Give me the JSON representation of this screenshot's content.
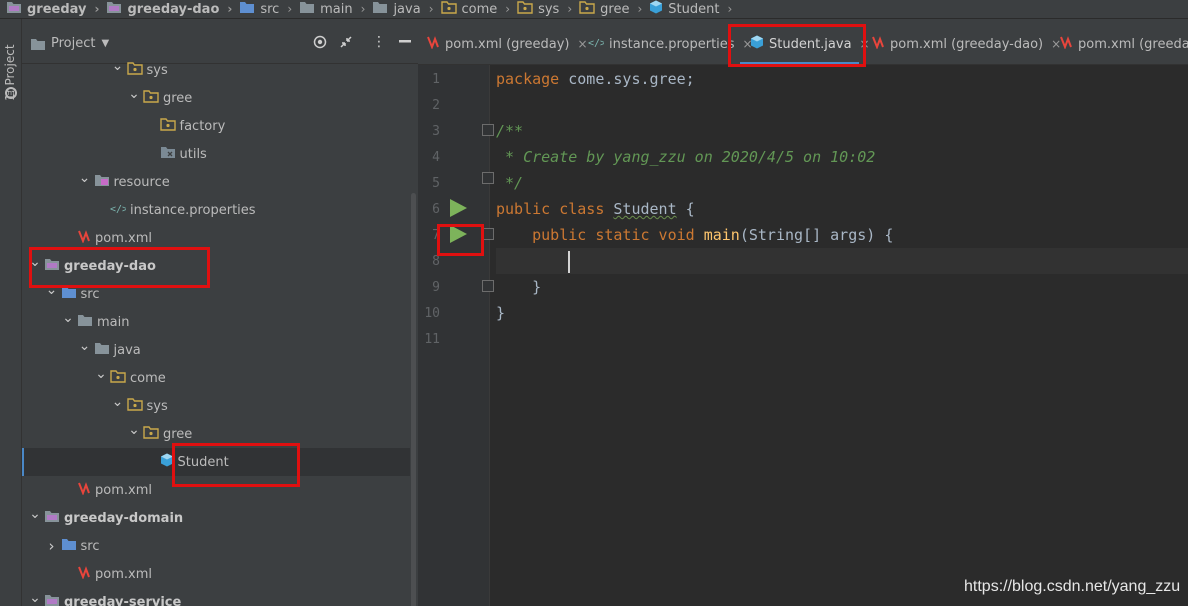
{
  "breadcrumb": [
    {
      "label": "greeday",
      "icon": "module-folder-icon",
      "bold": true
    },
    {
      "label": "greeday-dao",
      "icon": "module-folder-icon",
      "bold": true
    },
    {
      "label": "src",
      "icon": "source-folder-icon",
      "bold": false
    },
    {
      "label": "main",
      "icon": "folder-icon",
      "bold": false
    },
    {
      "label": "java",
      "icon": "folder-icon",
      "bold": false
    },
    {
      "label": "come",
      "icon": "package-icon",
      "bold": false
    },
    {
      "label": "sys",
      "icon": "package-icon",
      "bold": false
    },
    {
      "label": "gree",
      "icon": "package-icon",
      "bold": false
    },
    {
      "label": "Student",
      "icon": "java-class-icon",
      "bold": false
    }
  ],
  "toolstrip": {
    "project_label": "1: Project"
  },
  "project_panel": {
    "title": "Project"
  },
  "tree": [
    {
      "label": "sys",
      "arrow": "down",
      "icon": "package-icon",
      "indent": 6,
      "bold": false
    },
    {
      "label": "gree",
      "arrow": "down",
      "icon": "package-icon",
      "indent": 7,
      "bold": false
    },
    {
      "label": "factory",
      "arrow": "none",
      "icon": "package-icon",
      "indent": 8,
      "bold": false
    },
    {
      "label": "utils",
      "arrow": "none",
      "icon": "excluded-folder-icon",
      "indent": 8,
      "bold": false
    },
    {
      "label": "resource",
      "arrow": "down",
      "icon": "resource-folder-icon",
      "indent": 4,
      "bold": false
    },
    {
      "label": "instance.properties",
      "arrow": "none",
      "icon": "properties-file-icon",
      "indent": 5,
      "bold": false
    },
    {
      "label": "pom.xml",
      "arrow": "none",
      "icon": "maven-icon",
      "indent": 3,
      "bold": false
    },
    {
      "label": "greeday-dao",
      "arrow": "down",
      "icon": "module-folder-icon",
      "indent": 1,
      "bold": true
    },
    {
      "label": "src",
      "arrow": "down",
      "icon": "source-folder-icon",
      "indent": 2,
      "bold": false
    },
    {
      "label": "main",
      "arrow": "down",
      "icon": "folder-icon",
      "indent": 3,
      "bold": false
    },
    {
      "label": "java",
      "arrow": "down",
      "icon": "folder-icon",
      "indent": 4,
      "bold": false
    },
    {
      "label": "come",
      "arrow": "down",
      "icon": "package-icon",
      "indent": 5,
      "bold": false
    },
    {
      "label": "sys",
      "arrow": "down",
      "icon": "package-icon",
      "indent": 6,
      "bold": false
    },
    {
      "label": "gree",
      "arrow": "down",
      "icon": "package-icon",
      "indent": 7,
      "bold": false
    },
    {
      "label": "Student",
      "arrow": "none",
      "icon": "java-class-icon",
      "indent": 8,
      "bold": false,
      "selected": true
    },
    {
      "label": "pom.xml",
      "arrow": "none",
      "icon": "maven-icon",
      "indent": 3,
      "bold": false
    },
    {
      "label": "greeday-domain",
      "arrow": "down",
      "icon": "module-folder-icon",
      "indent": 1,
      "bold": true
    },
    {
      "label": "src",
      "arrow": "right",
      "icon": "source-folder-icon",
      "indent": 2,
      "bold": false
    },
    {
      "label": "pom.xml",
      "arrow": "none",
      "icon": "maven-icon",
      "indent": 3,
      "bold": false
    },
    {
      "label": "greeday-service",
      "arrow": "down",
      "icon": "module-folder-icon",
      "indent": 1,
      "bold": true
    }
  ],
  "tabs": [
    {
      "label": "pom.xml (greeday)",
      "icon": "maven-icon",
      "active": false
    },
    {
      "label": "instance.properties",
      "icon": "properties-file-icon",
      "active": false
    },
    {
      "label": "Student.java",
      "icon": "java-class-icon",
      "active": true
    },
    {
      "label": "pom.xml (greeday-dao)",
      "icon": "maven-icon",
      "active": false
    },
    {
      "label": "pom.xml (greeday-",
      "icon": "maven-icon",
      "active": false
    }
  ],
  "editor": {
    "line_numbers": [
      "1",
      "2",
      "3",
      "4",
      "5",
      "6",
      "7",
      "8",
      "9",
      "10",
      "11"
    ],
    "code": {
      "l1_kw": "package",
      "l1_rest": " come.sys.gree;",
      "l3": "/**",
      "l4": " * Create by yang_zzu on 2020/4/5 on 10:02",
      "l5": " */",
      "l6_kw": "public class",
      "l6_cls": "Student",
      "l6_rest": " {",
      "l7_kw": "public static void",
      "l7_fn": "main",
      "l7_rest": "(String[] args) {",
      "l9": "    }",
      "l10": "}"
    }
  },
  "watermark": "https://blog.csdn.net/yang_zzu",
  "colors": {
    "accent": "#4a88c7",
    "highlight_box": "#e01010",
    "run_icon": "#7db35b"
  }
}
